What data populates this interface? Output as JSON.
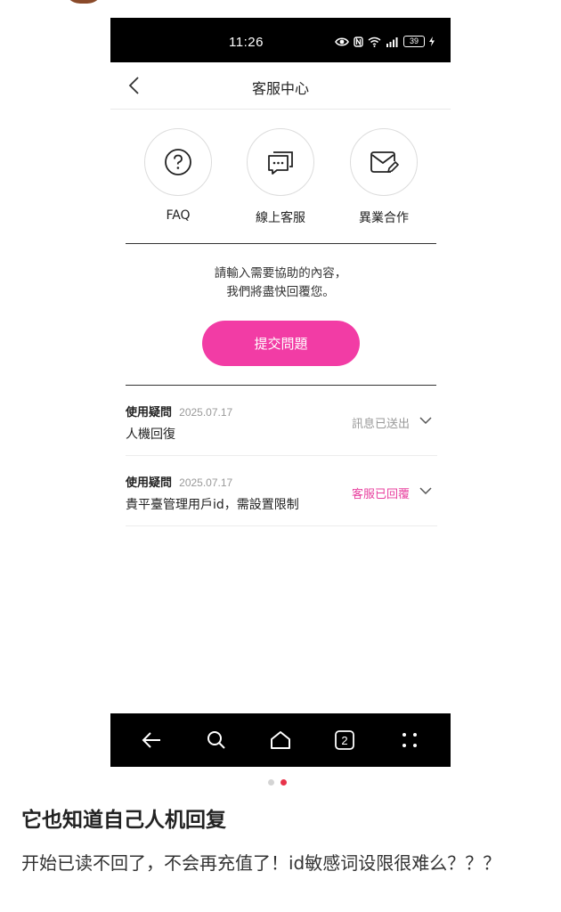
{
  "status_bar": {
    "time": "11:26",
    "battery": "39"
  },
  "header": {
    "title": "客服中心"
  },
  "services": [
    {
      "label": "FAQ",
      "icon": "question-circle-icon"
    },
    {
      "label": "線上客服",
      "icon": "chat-bubbles-icon"
    },
    {
      "label": "異業合作",
      "icon": "mail-edit-icon"
    }
  ],
  "prompt": {
    "line1": "請輸入需要協助的內容，",
    "line2": "我們將盡快回覆您。"
  },
  "submit_label": "提交問題",
  "tickets": [
    {
      "category": "使用疑問",
      "date": "2025.07.17",
      "subject": "人機回復",
      "status": "訊息已送出",
      "status_color": "#999999"
    },
    {
      "category": "使用疑問",
      "date": "2025.07.17",
      "subject": "貴平臺管理用戶id，需設置限制",
      "status": "客服已回覆",
      "status_color": "#e8409e"
    }
  ],
  "bottom_nav": {
    "tabs_count": "2"
  },
  "post": {
    "title": "它也知道自己人机回复",
    "body": "开始已读不回了，不会再充值了！id敏感词设限很难么？？？"
  },
  "colors": {
    "accent": "#f23ca5",
    "dot_active": "#e8334a"
  }
}
